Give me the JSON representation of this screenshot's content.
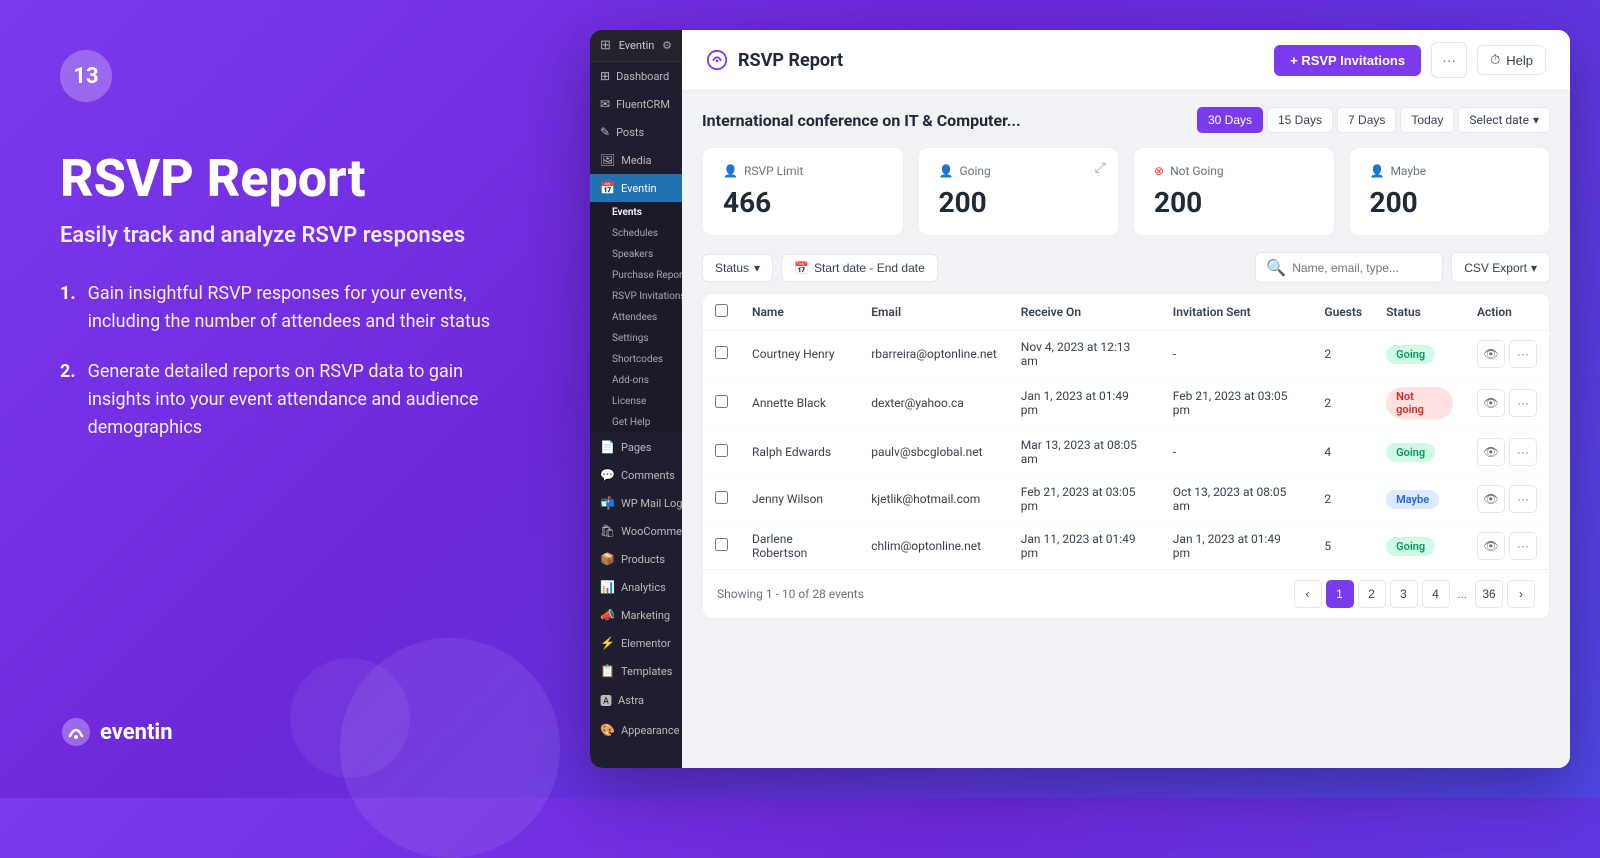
{
  "left": {
    "badge": "13",
    "title": "RSVP Report",
    "subtitle": "Easily track and analyze RSVP responses",
    "points": [
      "Gain insightful RSVP responses for your events, including the number of attendees and their status",
      "Generate detailed reports on RSVP data to gain insights into your event attendance and audience demographics"
    ],
    "logo_text": "eventin"
  },
  "wp_sidebar": {
    "top": "Eventin",
    "menu_items": [
      {
        "label": "Dashboard",
        "icon": "⊞"
      },
      {
        "label": "FluentCRM",
        "icon": "✉"
      },
      {
        "label": "Posts",
        "icon": "📝"
      },
      {
        "label": "Media",
        "icon": "🖼"
      },
      {
        "label": "Eventin",
        "icon": "📅",
        "active": true
      }
    ],
    "submenu": [
      {
        "label": "Events",
        "active": true
      },
      {
        "label": "Schedules"
      },
      {
        "label": "Speakers"
      },
      {
        "label": "Purchase Report"
      },
      {
        "label": "RSVP Invitations"
      },
      {
        "label": "Attendees"
      },
      {
        "label": "Settings"
      },
      {
        "label": "Shortcodes"
      },
      {
        "label": "Add-ons"
      },
      {
        "label": "License"
      },
      {
        "label": "Get Help"
      }
    ],
    "bottom_items": [
      {
        "label": "Pages",
        "icon": "📄"
      },
      {
        "label": "Comments",
        "icon": "💬"
      },
      {
        "label": "WP Mail Log",
        "icon": "📬"
      },
      {
        "label": "WooCommerce",
        "icon": "🛍"
      },
      {
        "label": "Products",
        "icon": "📦"
      },
      {
        "label": "Analytics",
        "icon": "📊"
      },
      {
        "label": "Marketing",
        "icon": "📣"
      },
      {
        "label": "Elementor",
        "icon": "⚡"
      },
      {
        "label": "Templates",
        "icon": "📋"
      },
      {
        "label": "Astra",
        "icon": "🅰"
      },
      {
        "label": "Appearance",
        "icon": "🎨"
      }
    ]
  },
  "header": {
    "title": "RSVP Report",
    "btn_rsvp_invitations": "+ RSVP Invitations",
    "btn_more": "···",
    "btn_help": "Help"
  },
  "event": {
    "title": "International conference on IT & Computer...",
    "date_filters": [
      "30 Days",
      "15 Days",
      "7 Days",
      "Today"
    ],
    "date_select": "Select date"
  },
  "stats": [
    {
      "label": "RSVP Limit",
      "value": "466",
      "icon_type": "rsvp"
    },
    {
      "label": "Going",
      "value": "200",
      "icon_type": "going"
    },
    {
      "label": "Not Going",
      "value": "200",
      "icon_type": "notgoing"
    },
    {
      "label": "Maybe",
      "value": "200",
      "icon_type": "maybe"
    }
  ],
  "toolbar": {
    "status_label": "Status",
    "date_range": "Start date - End date",
    "search_placeholder": "Name, email, type...",
    "csv_label": "CSV Export"
  },
  "table": {
    "columns": [
      "Name",
      "Email",
      "Receive On",
      "Invitation Sent",
      "Guests",
      "Status",
      "Action"
    ],
    "rows": [
      {
        "name": "Courtney Henry",
        "email": "rbarreira@optonline.net",
        "receive_on": "Nov 4, 2023 at 12:13 am",
        "invitation_sent": "-",
        "guests": "2",
        "status": "Going",
        "status_type": "going"
      },
      {
        "name": "Annette Black",
        "email": "dexter@yahoo.ca",
        "receive_on": "Jan 1, 2023 at 01:49 pm",
        "invitation_sent": "Feb 21, 2023 at 03:05 pm",
        "guests": "2",
        "status": "Not going",
        "status_type": "notgoing"
      },
      {
        "name": "Ralph Edwards",
        "email": "paulv@sbcglobal.net",
        "receive_on": "Mar 13, 2023 at 08:05 am",
        "invitation_sent": "-",
        "guests": "4",
        "status": "Going",
        "status_type": "going"
      },
      {
        "name": "Jenny Wilson",
        "email": "kjetlik@hotmail.com",
        "receive_on": "Feb 21, 2023 at 03:05 pm",
        "invitation_sent": "Oct 13, 2023 at 08:05 am",
        "guests": "2",
        "status": "Maybe",
        "status_type": "maybe"
      },
      {
        "name": "Darlene Robertson",
        "email": "chlim@optonline.net",
        "receive_on": "Jan 11, 2023 at 01:49 pm",
        "invitation_sent": "Jan 1, 2023 at 01:49 pm",
        "guests": "5",
        "status": "Going",
        "status_type": "going"
      }
    ]
  },
  "pagination": {
    "info": "Showing 1 - 10 of 28 events",
    "pages": [
      "1",
      "2",
      "3",
      "4",
      "...",
      "36"
    ],
    "active_page": "1"
  }
}
